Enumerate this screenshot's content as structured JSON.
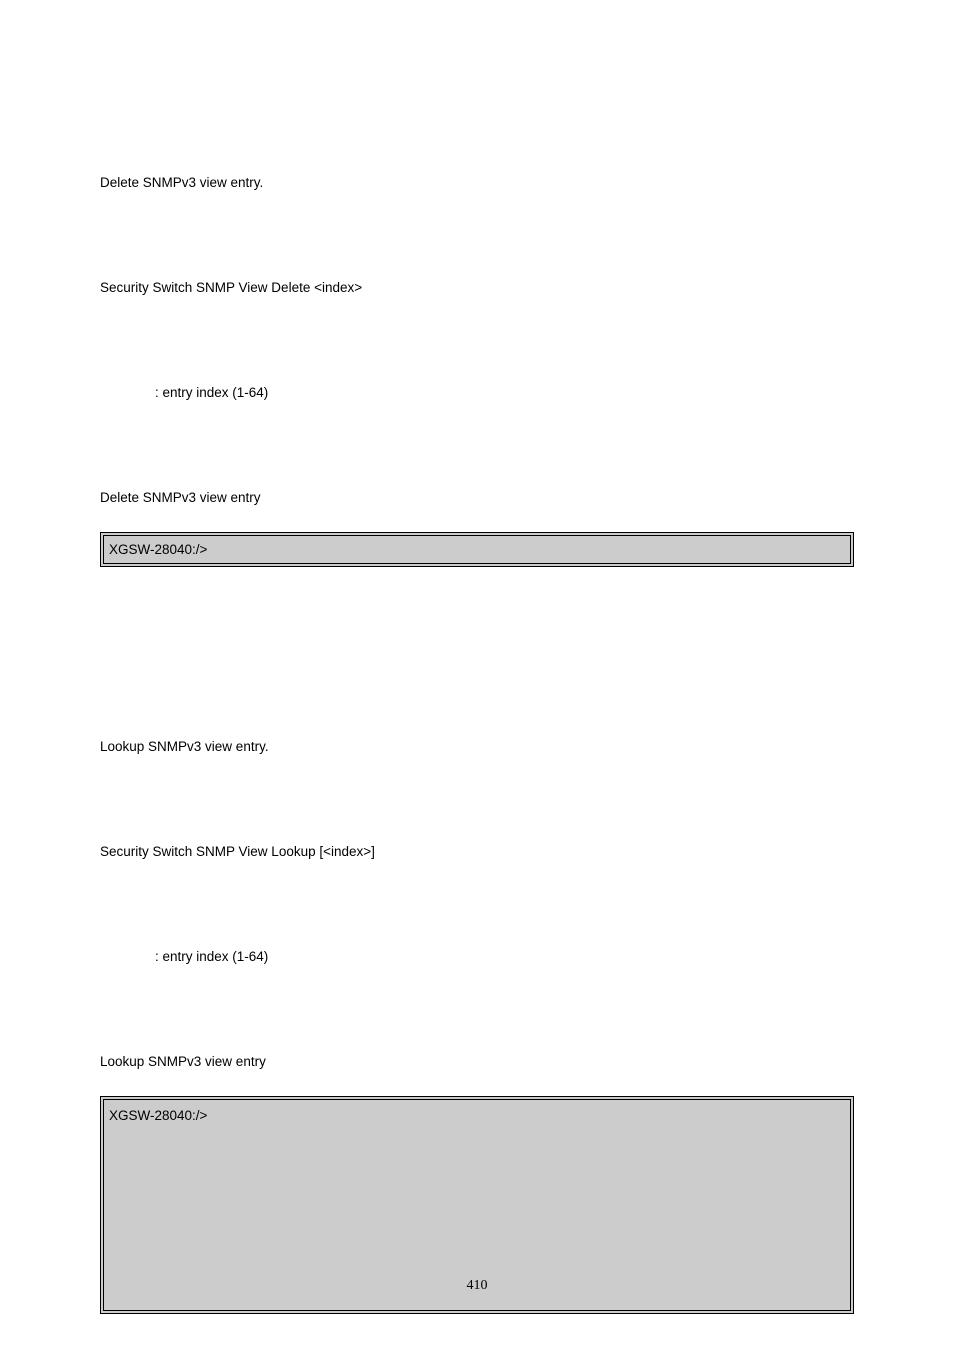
{
  "section1": {
    "desc": "Delete SNMPv3 view entry.",
    "syntax": "Security Switch SNMP View Delete <index>",
    "param": ": entry index (1-64)",
    "example_label": "Delete SNMPv3 view entry",
    "code": "XGSW-28040:/>"
  },
  "section2": {
    "desc": "Lookup SNMPv3 view entry.",
    "syntax": "Security Switch SNMP View Lookup [<index>]",
    "param": ": entry index (1-64)",
    "example_label": "Lookup SNMPv3 view entry",
    "code": "XGSW-28040:/>"
  },
  "page_number": "410"
}
